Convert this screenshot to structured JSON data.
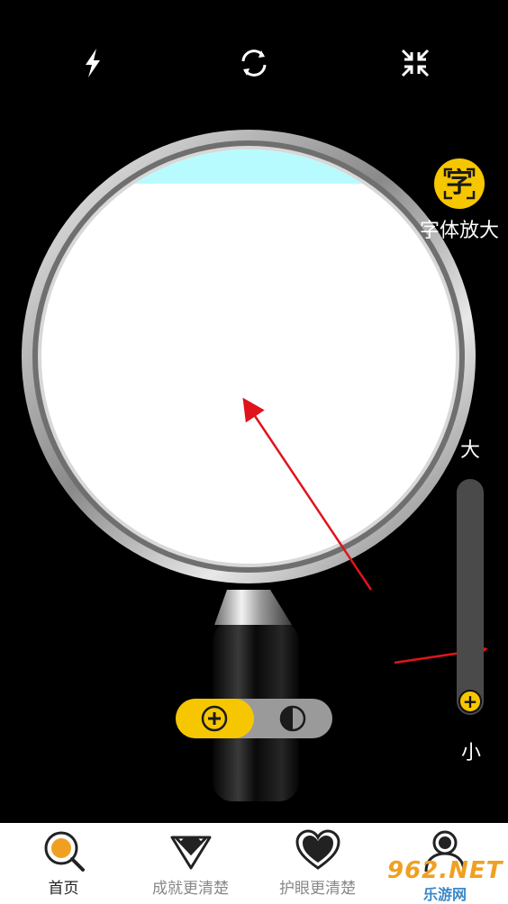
{
  "toolbar": {
    "flash_icon": "flash-icon",
    "switch_camera_icon": "rotate-camera-icon",
    "collapse_icon": "collapse-icon"
  },
  "font_zoom": {
    "glyph": "字",
    "label": "字体放大"
  },
  "zoom_slider": {
    "max_label": "大",
    "min_label": "小",
    "level": 0.0
  },
  "mode_toggle": {
    "active": "zoom",
    "options": [
      "zoom-in-icon",
      "contrast-icon"
    ]
  },
  "tabs": [
    {
      "label": "首页",
      "icon": "magnifier-icon",
      "active": true
    },
    {
      "label": "成就更清楚",
      "icon": "diamond-icon",
      "active": false
    },
    {
      "label": "护眼更清楚",
      "icon": "heart-icon",
      "active": false
    },
    {
      "label": "",
      "icon": "user-icon",
      "active": false
    }
  ],
  "watermark": {
    "text": "962.NET",
    "sub": "乐游网"
  },
  "colors": {
    "accent": "#f6c700",
    "background": "#000000",
    "lens_tint": "#b8fbff",
    "annotation_arrow": "#e0141b"
  }
}
